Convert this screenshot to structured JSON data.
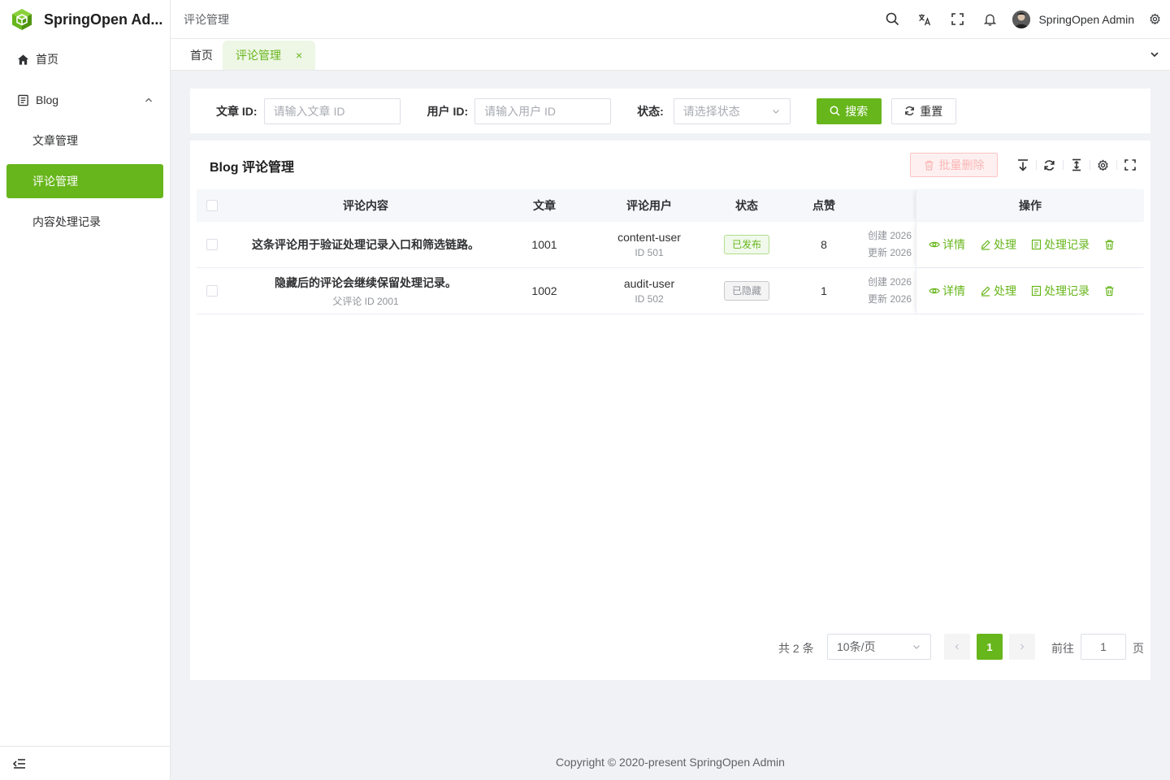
{
  "app": {
    "title": "SpringOpen Ad...",
    "brand_color": "#67b61b"
  },
  "sidebar": {
    "items": [
      {
        "label": "首页",
        "icon": "home-icon"
      },
      {
        "label": "Blog",
        "icon": "document-icon",
        "expanded": true,
        "children": [
          {
            "label": "文章管理"
          },
          {
            "label": "评论管理",
            "active": true
          },
          {
            "label": "内容处理记录"
          }
        ]
      }
    ],
    "collapse_icon": "collapse-menu-icon"
  },
  "header": {
    "breadcrumb": "评论管理",
    "icons": [
      "search-icon",
      "translate-icon",
      "fullscreen-icon",
      "bell-icon"
    ],
    "user_name": "SpringOpen Admin",
    "settings_icon": "gear-icon"
  },
  "tabs": [
    {
      "label": "首页"
    },
    {
      "label": "评论管理",
      "active": true,
      "close": "×"
    }
  ],
  "search": {
    "article_label": "文章 ID:",
    "article_placeholder": "请输入文章 ID",
    "user_label": "用户 ID:",
    "user_placeholder": "请输入用户 ID",
    "status_label": "状态:",
    "status_placeholder": "请选择状态",
    "search_btn": "搜索",
    "reset_btn": "重置"
  },
  "table": {
    "title": "Blog 评论管理",
    "batch_delete": "批量删除",
    "columns": [
      "评论内容",
      "文章",
      "评论用户",
      "状态",
      "点赞",
      "操作"
    ],
    "rows": [
      {
        "content": "这条评论用于验证处理记录入口和筛选链路。",
        "parent": "",
        "article": "1001",
        "user": "content-user",
        "user_id": "ID 501",
        "status": "已发布",
        "status_type": "success",
        "likes": "8",
        "created": "创建 2026",
        "updated": "更新 2026"
      },
      {
        "content": "隐藏后的评论会继续保留处理记录。",
        "parent": "父评论 ID 2001",
        "article": "1002",
        "user": "audit-user",
        "user_id": "ID 502",
        "status": "已隐藏",
        "status_type": "info",
        "likes": "1",
        "created": "创建 2026",
        "updated": "更新 2026"
      }
    ],
    "ops": {
      "detail": "详情",
      "handle": "处理",
      "records": "处理记录"
    }
  },
  "pager": {
    "total": "共 2 条",
    "page_size": "10条/页",
    "current": "1",
    "goto_label": "前往",
    "goto_value": "1",
    "goto_suffix": "页"
  },
  "footer": "Copyright © 2020-present SpringOpen Admin"
}
